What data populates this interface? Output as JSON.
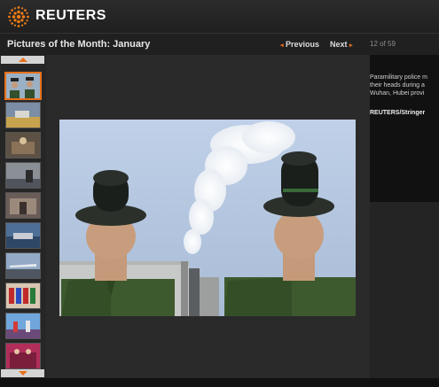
{
  "header": {
    "brand": "REUTERS",
    "logo_icon": "reuters-dot-logo-icon"
  },
  "gallery": {
    "title": "Pictures of the Month: January",
    "previous_label": "Previous",
    "next_label": "Next",
    "counter": "12 of 59"
  },
  "caption": {
    "lines": [
      "Paramilitary police m",
      "their heads during a",
      "Wuhan, Hubei provi"
    ],
    "credit": "REUTERS/Stringer"
  },
  "colors": {
    "accent": "#e8701a",
    "background": "#161616",
    "header": "#262626"
  }
}
